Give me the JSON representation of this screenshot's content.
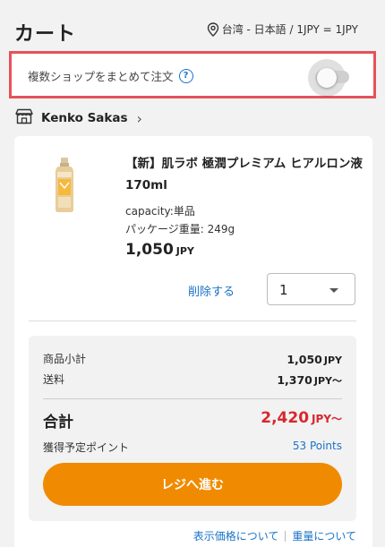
{
  "header": {
    "title": "カート",
    "region": "台湾 - 日本語 / 1JPY = 1JPY"
  },
  "multi_shop": {
    "label": "複数ショップをまとめて注文",
    "help": "?",
    "toggle_on": false
  },
  "shop": {
    "name": "Kenko Sakas",
    "chevron": "›"
  },
  "product": {
    "name": "【新】肌ラボ 極潤プレミアム ヒアルロン液 170ml",
    "capacity": "capacity:単品",
    "package_weight": "パッケージ重量: 249g",
    "price": "1,050",
    "price_unit": "JPY",
    "delete_label": "削除する",
    "quantity": "1"
  },
  "summary": {
    "subtotal_label": "商品小計",
    "subtotal_value": "1,050",
    "subtotal_unit": "JPY",
    "shipping_label": "送料",
    "shipping_value": "1,370",
    "shipping_unit": "JPY〜",
    "total_label": "合計",
    "total_value": "2,420",
    "total_unit": "JPY〜",
    "points_label": "獲得予定ポイント",
    "points_value": "53 Points",
    "checkout_label": "レジへ進む"
  },
  "footer": {
    "price_link": "表示価格について",
    "weight_link": "重量について"
  },
  "colors": {
    "accent_blue": "#1a73c8",
    "checkout_orange": "#f08a00",
    "total_red": "#d9262e",
    "highlight_border": "#e5525a"
  }
}
